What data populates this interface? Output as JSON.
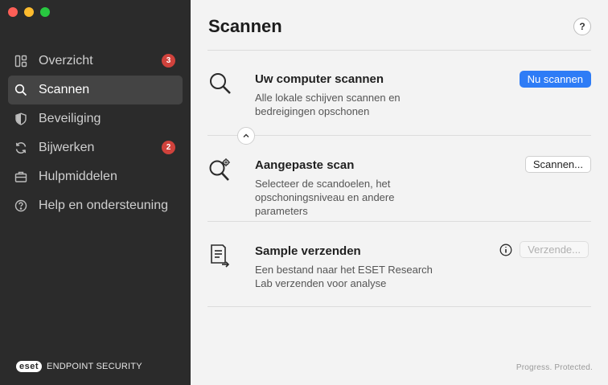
{
  "sidebar": {
    "items": [
      {
        "label": "Overzicht",
        "icon": "dashboard-icon",
        "badge": "3"
      },
      {
        "label": "Scannen",
        "icon": "search-icon",
        "active": true
      },
      {
        "label": "Beveiliging",
        "icon": "shield-icon"
      },
      {
        "label": "Bijwerken",
        "icon": "refresh-icon",
        "badge": "2"
      },
      {
        "label": "Hulpmiddelen",
        "icon": "briefcase-icon"
      },
      {
        "label": "Help en ondersteuning",
        "icon": "help-circle-icon"
      }
    ],
    "brand": {
      "logo": "eset",
      "product": "ENDPOINT SECURITY"
    }
  },
  "main": {
    "title": "Scannen",
    "help_label": "?",
    "rows": [
      {
        "title": "Uw computer scannen",
        "description": "Alle lokale schijven scannen en bedreigingen opschonen",
        "button": "Nu scannen",
        "icon": "magnifier-icon"
      },
      {
        "title": "Aangepaste scan",
        "description": "Selecteer de scandoelen, het opschoningsniveau en andere parameters",
        "button": "Scannen...",
        "icon": "magnifier-gear-icon"
      },
      {
        "title": "Sample verzenden",
        "description": "Een bestand naar het ESET Research Lab verzenden voor analyse",
        "button": "Verzende...",
        "icon": "document-send-icon"
      }
    ],
    "tagline": "Progress. Protected."
  },
  "colors": {
    "sidebar_bg": "#2b2b2b",
    "accent": "#2e7cf6",
    "badge": "#d0423c"
  }
}
